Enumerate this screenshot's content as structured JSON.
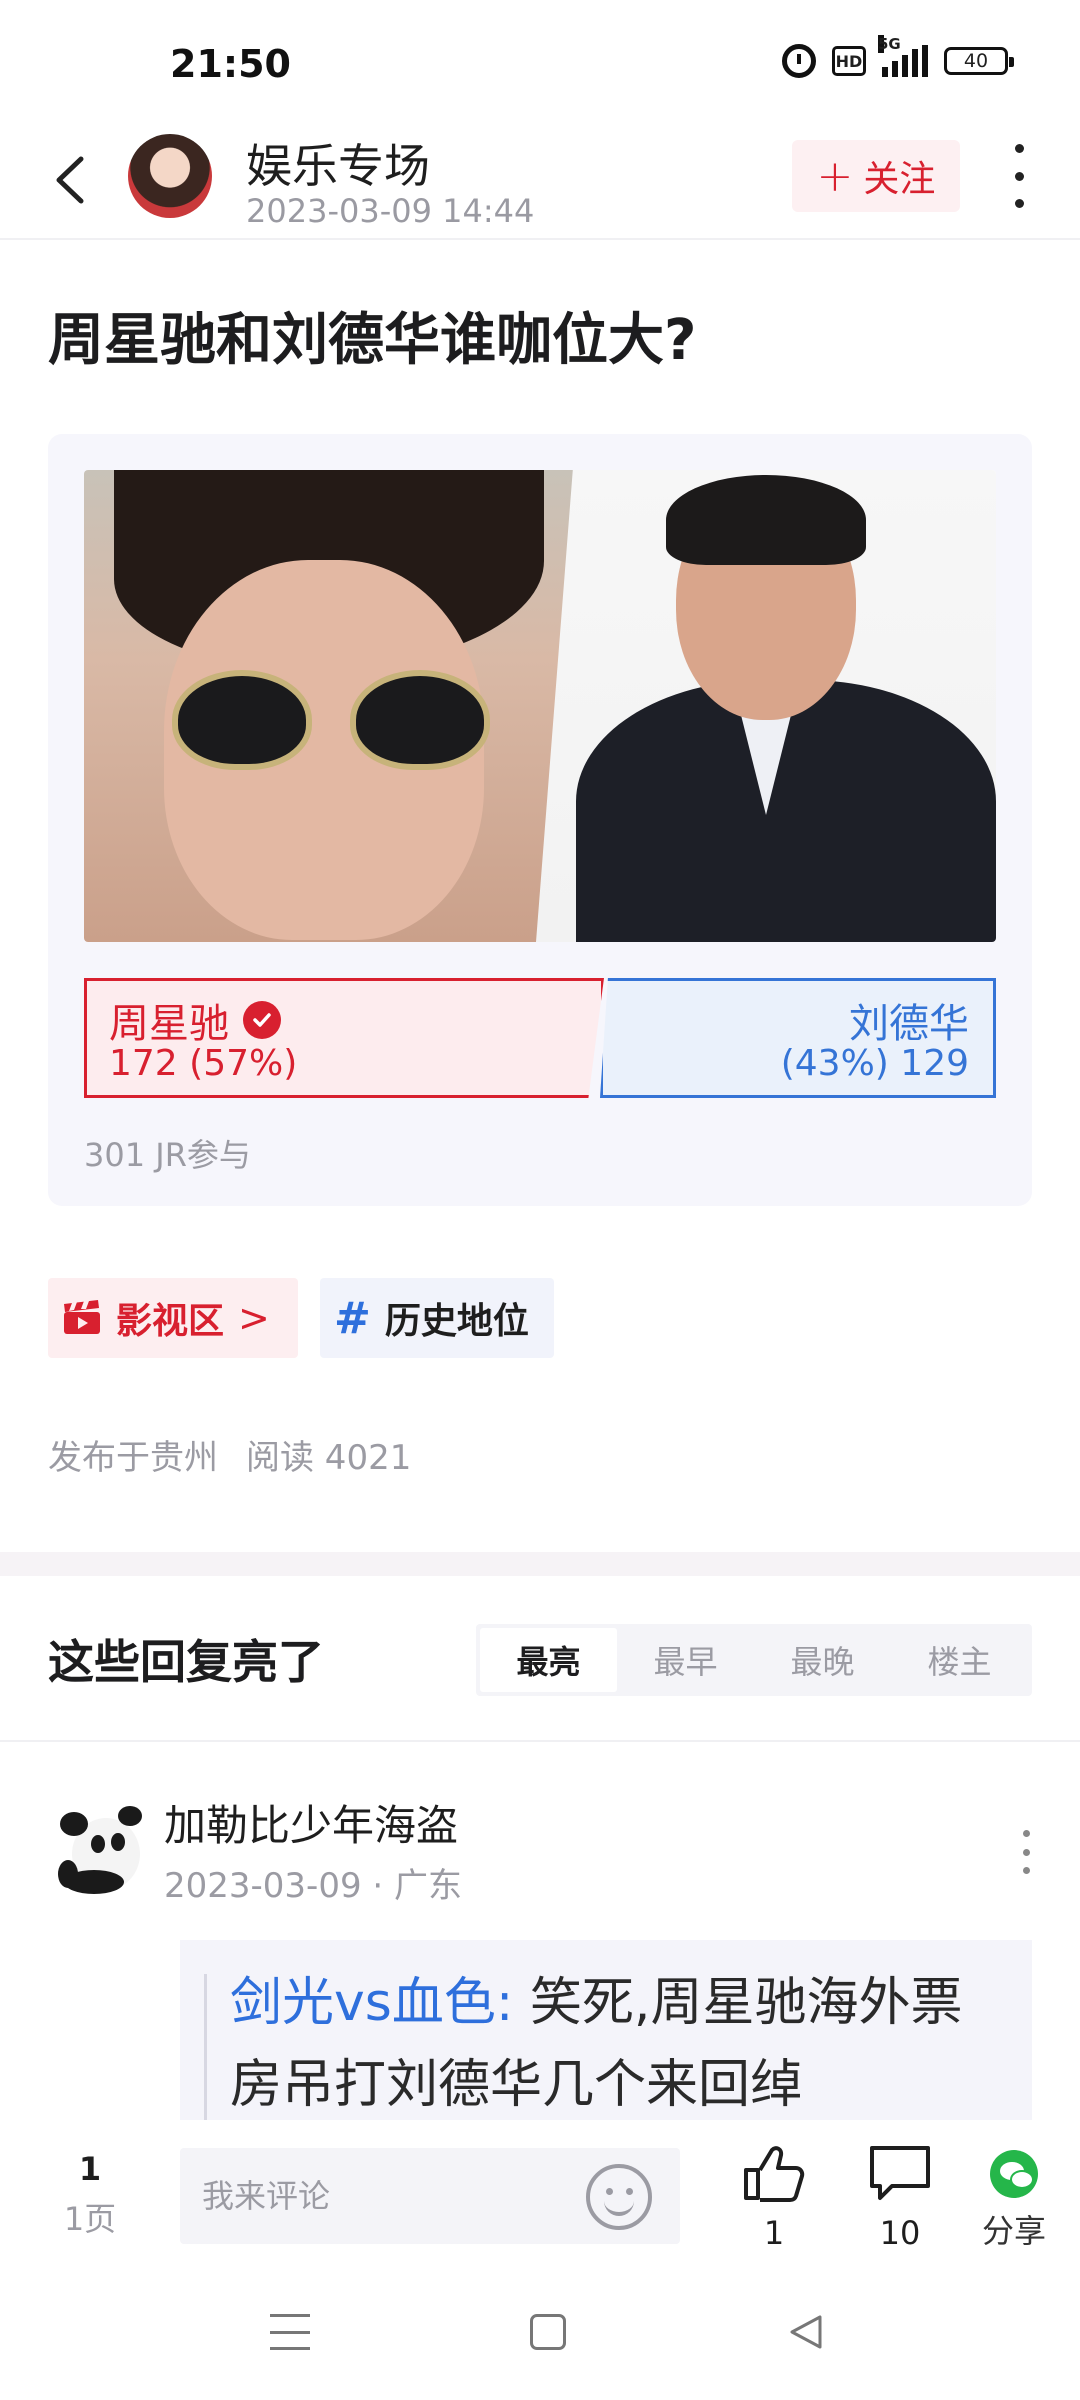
{
  "status_bar": {
    "time": "21:50",
    "network": "5G",
    "hd": "HD",
    "battery": "40"
  },
  "header": {
    "channel_name": "娱乐专场",
    "post_time": "2023-03-09 14:44",
    "follow_icon": "+",
    "follow_label": "关注"
  },
  "post": {
    "title": "周星驰和刘德华谁咖位大?"
  },
  "vote": {
    "left": {
      "name": "周星驰",
      "count_text": "172 (57%)",
      "votes": 172,
      "percent": 57
    },
    "right": {
      "name": "刘德华",
      "count_text": "(43%) 129",
      "votes": 129,
      "percent": 43
    },
    "participants": "301 JR参与",
    "colors": {
      "left": "#d8202f",
      "right": "#3574d6"
    }
  },
  "tags": {
    "board": "影视区",
    "board_arrow": ">",
    "topic_hash": "#",
    "topic": "历史地位"
  },
  "meta": {
    "location": "发布于贵州",
    "reads": "阅读 4021"
  },
  "replies": {
    "title": "这些回复亮了",
    "sort_tabs": [
      "最亮",
      "最早",
      "最晚",
      "楼主"
    ],
    "active_tab": 0
  },
  "comment": {
    "author": "加勒比少年海盗",
    "meta": "2023-03-09 · 广东",
    "quote_user": "剑光vs血色:",
    "quote_text": "笑死,周星驰海外票房吊打刘德华几个来回绰"
  },
  "bottom_bar": {
    "page_number": "1",
    "page_label": "1页",
    "comment_placeholder": "我来评论",
    "likes": "1",
    "comments": "10",
    "share_label": "分享"
  },
  "accent_color": "#d8202f"
}
